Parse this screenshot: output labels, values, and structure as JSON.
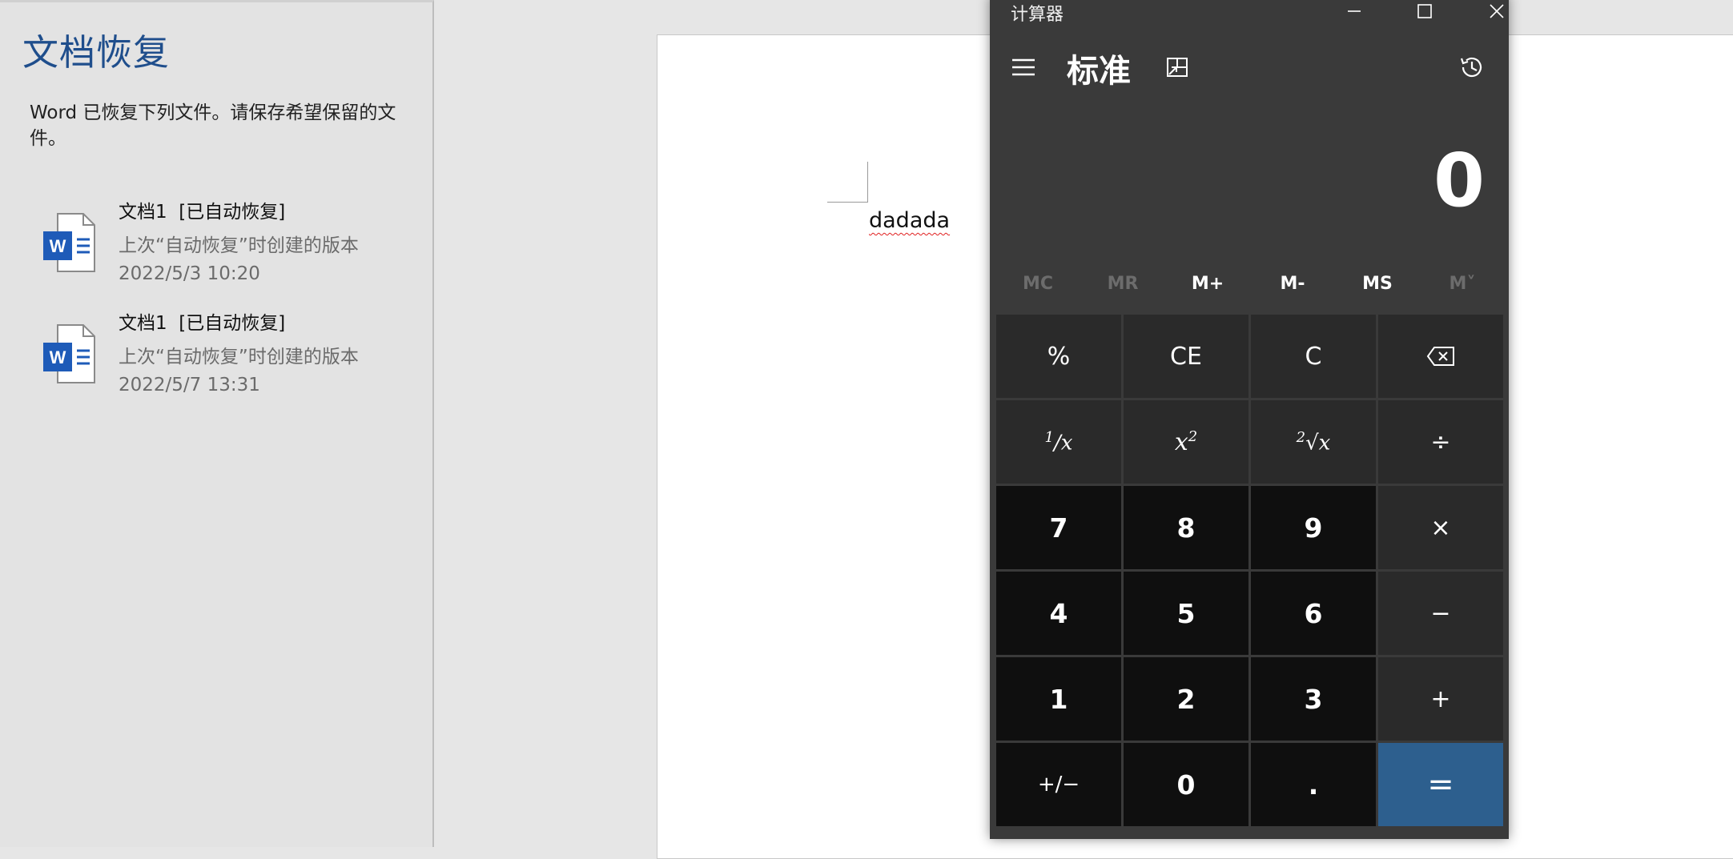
{
  "recovery": {
    "title": "文档恢复",
    "description": "Word 已恢复下列文件。请保存希望保留的文件。",
    "files": [
      {
        "name": "文档1  [已自动恢复]",
        "subtitle": "上次“自动恢复”时创建的版本",
        "time": "2022/5/3 10:20",
        "icon": "word-doc-icon"
      },
      {
        "name": "文档1  [已自动恢复]",
        "subtitle": "上次“自动恢复”时创建的版本",
        "time": "2022/5/7 13:31",
        "icon": "word-doc-icon"
      }
    ]
  },
  "document": {
    "text": "dadada"
  },
  "calculator": {
    "title": "计算器",
    "mode": "标准",
    "display": "0",
    "memory": [
      "MC",
      "MR",
      "M+",
      "M-",
      "MS",
      "M˅"
    ],
    "keys": {
      "percent": "%",
      "ce": "CE",
      "c": "C",
      "reciprocal_num": "1",
      "reciprocal_den": "x",
      "square_base": "x",
      "square_exp": "2",
      "sqrt_index": "2",
      "sqrt_radicand": "x",
      "divide": "÷",
      "seven": "7",
      "eight": "8",
      "nine": "9",
      "multiply": "×",
      "four": "4",
      "five": "5",
      "six": "6",
      "minus": "−",
      "one": "1",
      "two": "2",
      "three": "3",
      "plus": "+",
      "negate": "+/−",
      "zero": "0",
      "decimal": ".",
      "equals": "="
    },
    "colors": {
      "accent_equals": "#2d5f8e",
      "background": "#3a3a3a"
    }
  }
}
